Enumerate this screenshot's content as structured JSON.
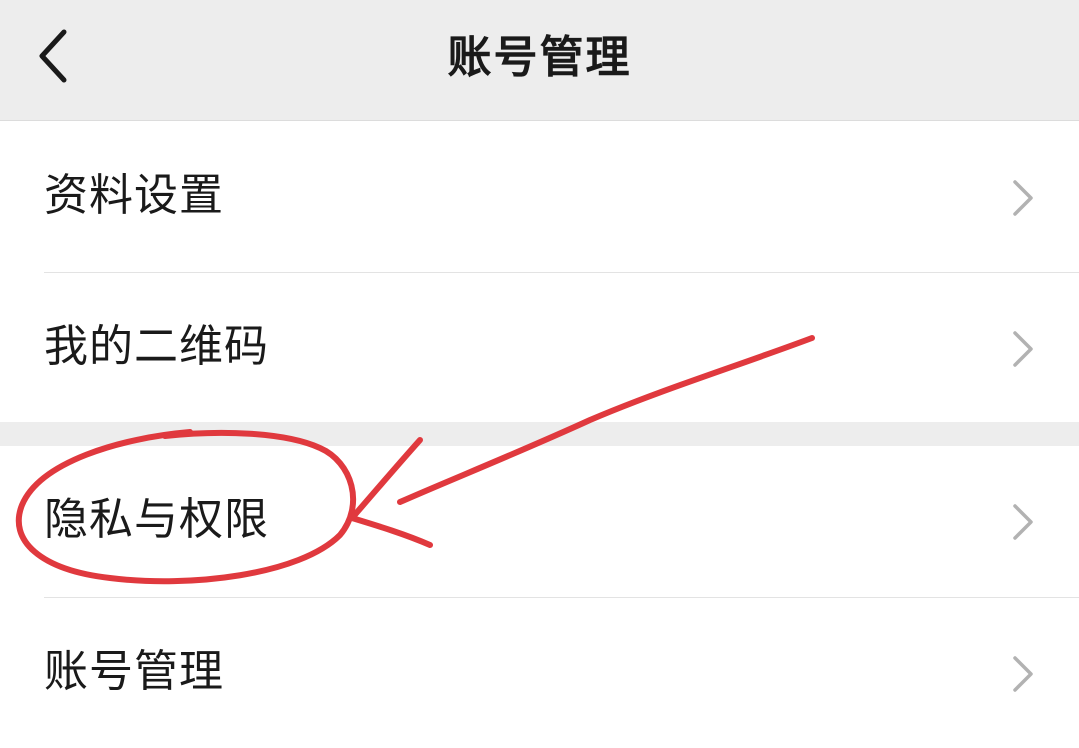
{
  "header": {
    "title": "账号管理",
    "back_icon": "chevron-left-icon"
  },
  "groups": [
    {
      "items": [
        {
          "label": "资料设置",
          "icon": "chevron-right-icon"
        },
        {
          "label": "我的二维码",
          "icon": "chevron-right-icon"
        }
      ]
    },
    {
      "items": [
        {
          "label": "隐私与权限",
          "icon": "chevron-right-icon",
          "annotated": true
        },
        {
          "label": "账号管理",
          "icon": "chevron-right-icon"
        }
      ]
    }
  ],
  "colors": {
    "header_bg": "#ededed",
    "text": "#1a1a1a",
    "chevron": "#b2b2b2",
    "annotation": "#e0393e"
  }
}
